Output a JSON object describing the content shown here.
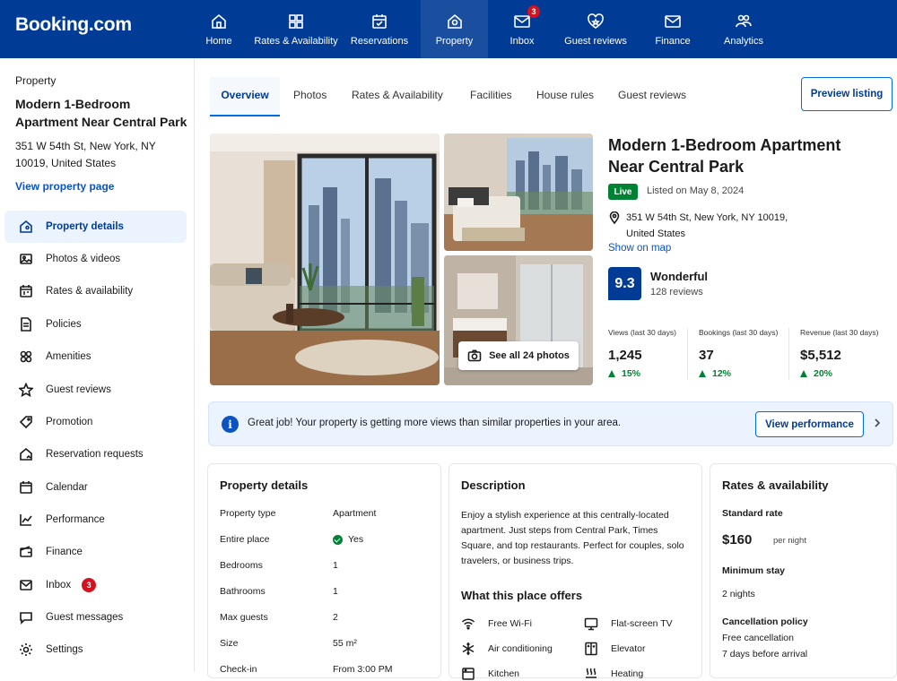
{
  "brand": "Booking.com",
  "nav": [
    {
      "label": "Home",
      "icon": "home-icon"
    },
    {
      "label": "Rates & Availability",
      "icon": "rates-icon"
    },
    {
      "label": "Reservations",
      "icon": "reservations-icon"
    },
    {
      "label": "Property",
      "icon": "property-icon",
      "active": true
    },
    {
      "label": "Inbox",
      "icon": "inbox-icon",
      "badge": "3"
    },
    {
      "label": "Guest reviews",
      "icon": "guest-reviews-icon"
    },
    {
      "label": "Finance",
      "icon": "finance-icon"
    },
    {
      "label": "Analytics",
      "icon": "analytics-icon"
    }
  ],
  "sidebar": {
    "kicker": "Property",
    "title": "Modern 1-Bedroom Apartment Near Central Park",
    "address": "351 W 54th St, New York, NY 10019, United States",
    "link": "View property page",
    "items": [
      {
        "label": "Property details",
        "icon": "building-icon",
        "active": true
      },
      {
        "label": "Photos & videos",
        "icon": "image-icon"
      },
      {
        "label": "Rates & availability",
        "icon": "calendar-icon"
      },
      {
        "label": "Policies",
        "icon": "document-icon"
      },
      {
        "label": "Amenities",
        "icon": "amenities-icon"
      },
      {
        "label": "Guest reviews",
        "icon": "star-icon"
      },
      {
        "label": "Promotion",
        "icon": "tag-icon"
      },
      {
        "label": "Reservation requests",
        "icon": "request-icon"
      },
      {
        "label": "Calendar",
        "icon": "calendar-icon"
      },
      {
        "label": "Performance",
        "icon": "chart-icon"
      },
      {
        "label": "Finance",
        "icon": "wallet-icon"
      },
      {
        "label": "Inbox",
        "icon": "mail-icon",
        "badge": "3"
      },
      {
        "label": "Guest messages",
        "icon": "chat-icon"
      },
      {
        "label": "Settings",
        "icon": "gear-icon"
      }
    ]
  },
  "tabs": [
    "Overview",
    "Photos",
    "Rates & Availability",
    "Facilities",
    "House rules",
    "Guest reviews"
  ],
  "preview_label": "Preview listing",
  "see_all_photos": "See all 24 photos",
  "property": {
    "title": "Modern 1-Bedroom Apartment Near Central Park",
    "status": "Live",
    "listed": "Listed on May 8, 2024",
    "address": "351 W 54th St, New York, NY 10019, United States",
    "map_link": "Show on map",
    "score": "9.3",
    "score_word": "Wonderful",
    "reviews": "128 reviews"
  },
  "stats": [
    {
      "label": "Views (last 30 days)",
      "value": "1,245",
      "change": "15%"
    },
    {
      "label": "Bookings (last 30 days)",
      "value": "37",
      "change": "12%"
    },
    {
      "label": "Revenue (last 30 days)",
      "value": "$5,512",
      "change": "20%"
    }
  ],
  "banner": {
    "text": "Great job! Your property is getting more views than similar properties in your area.",
    "button": "View performance"
  },
  "details": {
    "heading": "Property details",
    "rows": [
      {
        "k": "Property type",
        "v": "Apartment"
      },
      {
        "k": "Entire place",
        "v": "Yes"
      },
      {
        "k": "Bedrooms",
        "v": "1"
      },
      {
        "k": "Bathrooms",
        "v": "1"
      },
      {
        "k": "Max guests",
        "v": "2"
      },
      {
        "k": "Size",
        "v": "55 m²"
      },
      {
        "k": "Check-in",
        "v": "From 3:00 PM"
      }
    ]
  },
  "description": {
    "heading": "Description",
    "text": "Enjoy a stylish experience at this centrally-located apartment. Just steps from Central Park, Times Square, and top restaurants. Perfect for couples, solo travelers, or business trips.",
    "offers_heading": "What this place offers",
    "amenities": [
      {
        "label": "Free Wi-Fi",
        "icon": "wifi-icon"
      },
      {
        "label": "Flat-screen TV",
        "icon": "tv-icon"
      },
      {
        "label": "Air conditioning",
        "icon": "snowflake-icon"
      },
      {
        "label": "Elevator",
        "icon": "elevator-icon"
      },
      {
        "label": "Kitchen",
        "icon": "kitchen-icon"
      },
      {
        "label": "Heating",
        "icon": "heating-icon"
      }
    ]
  },
  "rates": {
    "heading": "Rates & availability",
    "std_label": "Standard rate",
    "price": "$160",
    "per_night": "per night",
    "min_label": "Minimum stay",
    "min_value": "2 nights",
    "cancel_label": "Cancellation policy",
    "cancel_line1": "Free cancellation",
    "cancel_line2": "7 days before arrival"
  },
  "colors": {
    "brand": "#003b95",
    "accent": "#006ce4",
    "success": "#008234",
    "alert": "#d4111e"
  }
}
